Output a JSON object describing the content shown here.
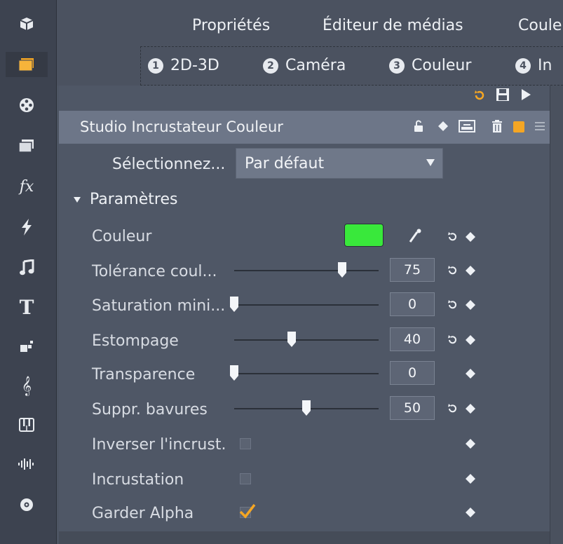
{
  "tabs": [
    "Propriétés",
    "Éditeur de médias",
    "Coule"
  ],
  "steps": [
    {
      "num": "1",
      "label": "2D-3D"
    },
    {
      "num": "2",
      "label": "Caméra"
    },
    {
      "num": "3",
      "label": "Couleur"
    },
    {
      "num": "4",
      "label": "In"
    }
  ],
  "effect": {
    "title": "Studio Incrustateur Couleur"
  },
  "preset": {
    "label": "Sélectionnez...",
    "value": "Par défaut"
  },
  "section": {
    "label": "Paramètres"
  },
  "params": {
    "color": {
      "label": "Couleur",
      "swatch": "#39e83b"
    },
    "tolerance": {
      "label": "Tolérance coul...",
      "value": "75"
    },
    "saturation": {
      "label": "Saturation mini...",
      "value": "0"
    },
    "estompage": {
      "label": "Estompage",
      "value": "40"
    },
    "transparence": {
      "label": "Transparence",
      "value": "0"
    },
    "bavures": {
      "label": "Suppr. bavures",
      "value": "50"
    },
    "inverser": {
      "label": "Inverser l'incrust.",
      "checked": false
    },
    "incrustation": {
      "label": "Incrustation",
      "checked": false
    },
    "alpha": {
      "label": "Garder Alpha",
      "checked": true
    }
  },
  "colors": {
    "accent": "#f5a623",
    "swatch": "#39e83b"
  }
}
